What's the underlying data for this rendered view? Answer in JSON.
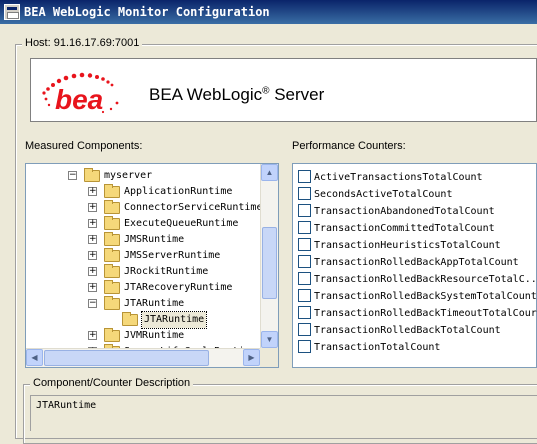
{
  "window": {
    "title": "BEA WebLogic Monitor Configuration",
    "icon": "app-window-icon"
  },
  "host": {
    "label": "Host: 91.16.17.69:7001"
  },
  "banner": {
    "logo_text": "bea",
    "brand_text": "BEA WebLogic",
    "brand_reg": "®",
    "brand_suffix": " Server",
    "logo_color": "#e8141c"
  },
  "components": {
    "label": "Measured Components:",
    "tree": [
      {
        "text": "myserver",
        "expander": "−",
        "level": 0
      },
      {
        "text": "ApplicationRuntime",
        "expander": "+",
        "level": 1
      },
      {
        "text": "ConnectorServiceRuntime",
        "expander": "+",
        "level": 1
      },
      {
        "text": "ExecuteQueueRuntime",
        "expander": "+",
        "level": 1
      },
      {
        "text": "JMSRuntime",
        "expander": "+",
        "level": 1
      },
      {
        "text": "JMSServerRuntime",
        "expander": "+",
        "level": 1
      },
      {
        "text": "JRockitRuntime",
        "expander": "+",
        "level": 1
      },
      {
        "text": "JTARecoveryRuntime",
        "expander": "+",
        "level": 1
      },
      {
        "text": "JTARuntime",
        "expander": "−",
        "level": 1
      },
      {
        "text": "JTARuntime",
        "expander": "",
        "level": 2,
        "selected": true
      },
      {
        "text": "JVMRuntime",
        "expander": "+",
        "level": 1
      },
      {
        "text": "ServerLifeCycleRuntime",
        "expander": "+",
        "level": 1
      }
    ]
  },
  "counters": {
    "label": "Performance Counters:",
    "items": [
      "ActiveTransactionsTotalCount",
      "SecondsActiveTotalCount",
      "TransactionAbandonedTotalCount",
      "TransactionCommittedTotalCount",
      "TransactionHeuristicsTotalCount",
      "TransactionRolledBackAppTotalCount",
      "TransactionRolledBackResourceTotalC...",
      "TransactionRolledBackSystemTotalCount",
      "TransactionRolledBackTimeoutTotalCour",
      "TransactionRolledBackTotalCount",
      "TransactionTotalCount"
    ]
  },
  "description": {
    "label": "Component/Counter Description",
    "text": "JTARuntime"
  }
}
